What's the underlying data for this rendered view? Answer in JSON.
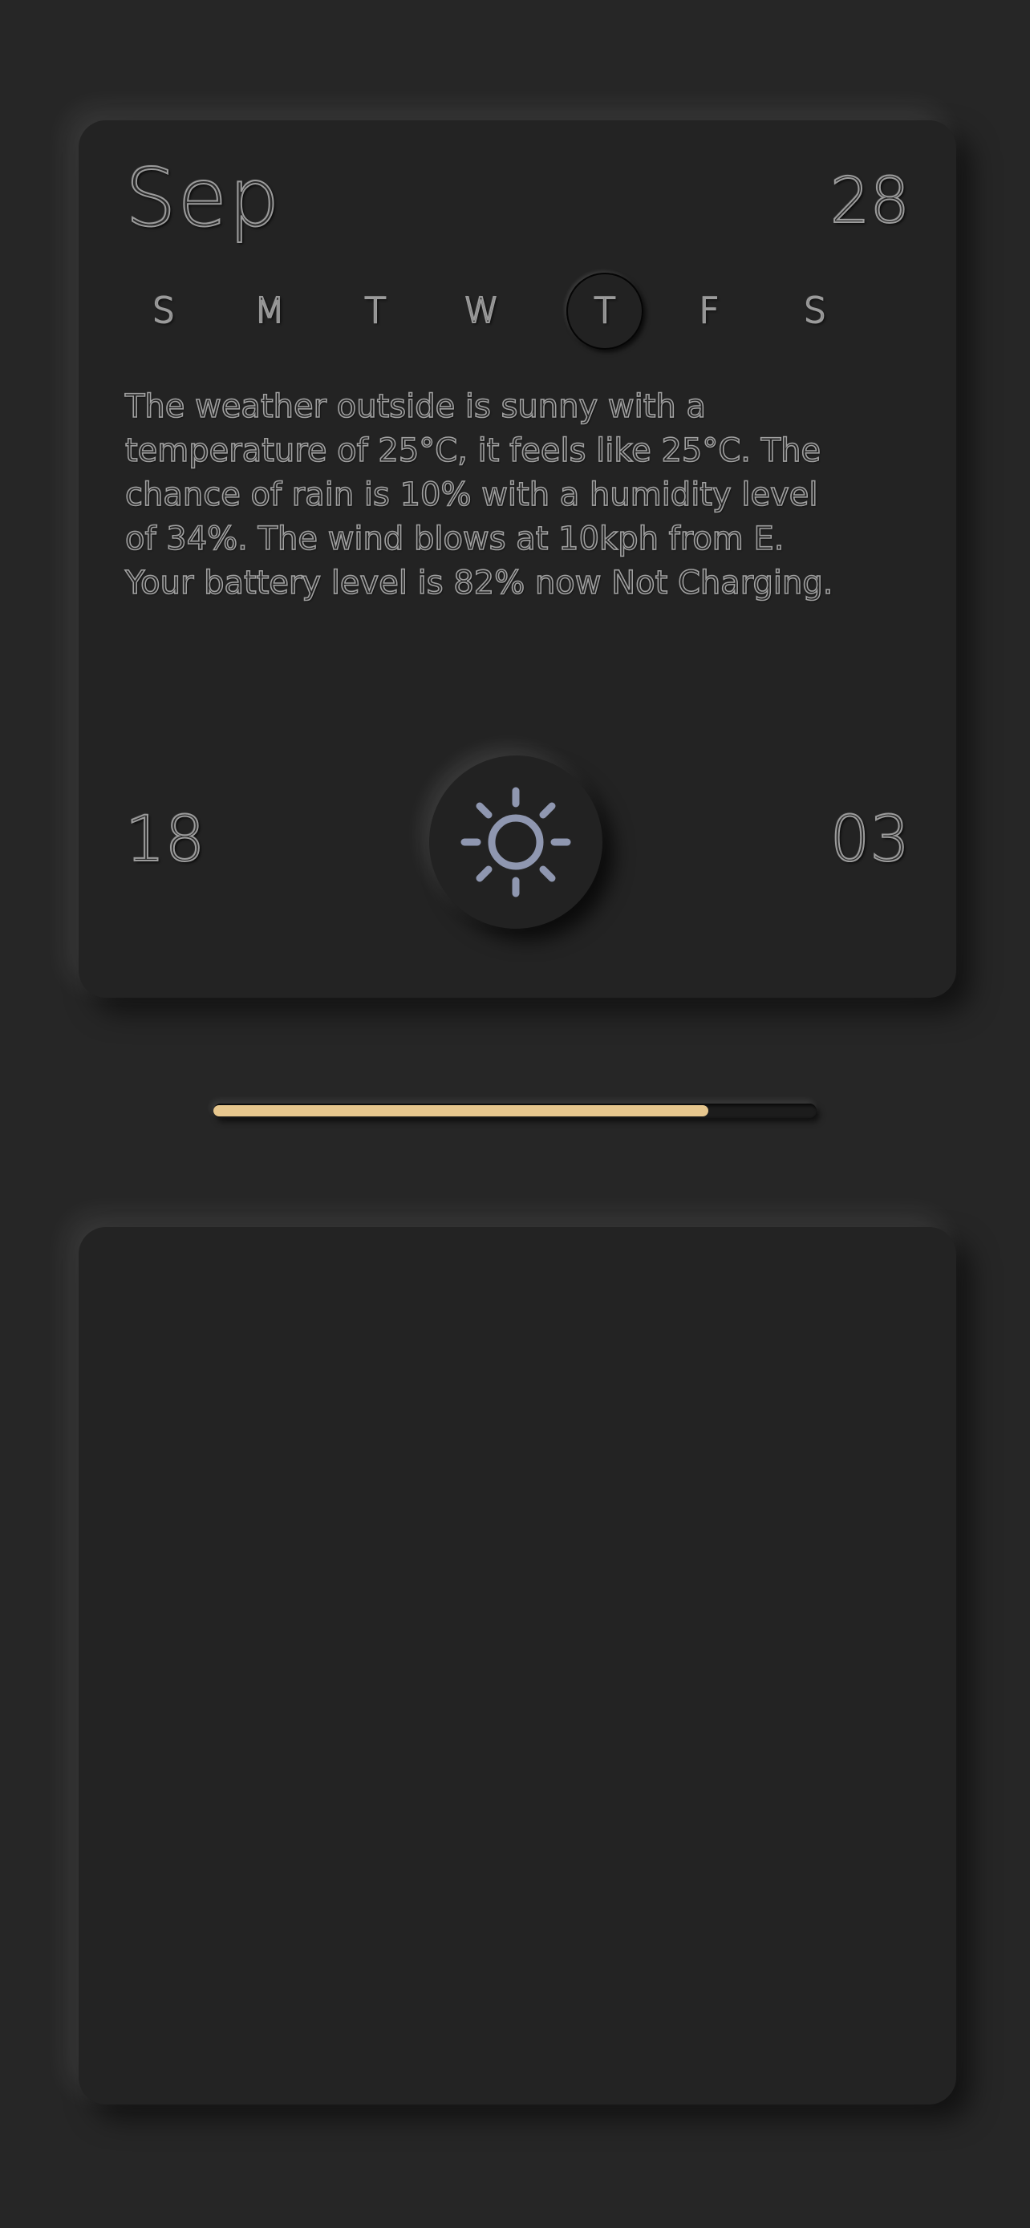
{
  "calendar": {
    "month": "Sep",
    "day": "28",
    "weekdays": [
      "S",
      "M",
      "T",
      "W",
      "T",
      "F",
      "S"
    ],
    "current_weekday_index": 4
  },
  "weather": {
    "description": "The weather outside is sunny with a temperature of 25°C, it feels like 25°C. The chance of rain is 10% with a humidity level of 34%. The wind blows at 10kph from E. Your battery level is 82% now Not Charging.",
    "icon": "sun-icon",
    "icon_color": "#8f97b0"
  },
  "clock": {
    "hour": "18",
    "minute": "03"
  },
  "battery": {
    "level_fraction": 0.82,
    "fill_color": "#e7c78e"
  }
}
